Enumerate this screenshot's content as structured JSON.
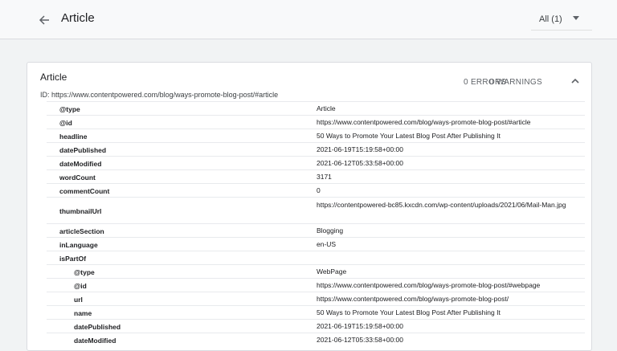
{
  "header": {
    "title": "Article",
    "filter_label": "All (1)"
  },
  "card": {
    "title": "Article",
    "errors": "0 ERRORS",
    "warnings": "0 WARNINGS",
    "id_line": "ID: https://www.contentpowered.com/blog/ways-promote-blog-post/#article"
  },
  "rows": [
    {
      "key": "@type",
      "value": "Article"
    },
    {
      "key": "@id",
      "value": "https://www.contentpowered.com/blog/ways-promote-blog-post/#article"
    },
    {
      "key": "headline",
      "value": "50 Ways to Promote Your Latest Blog Post After Publishing It"
    },
    {
      "key": "datePublished",
      "value": "2021-06-19T15:19:58+00:00"
    },
    {
      "key": "dateModified",
      "value": "2021-06-12T05:33:58+00:00"
    },
    {
      "key": "wordCount",
      "value": "3171"
    },
    {
      "key": "commentCount",
      "value": "0"
    },
    {
      "key": "thumbnailUrl",
      "value": "https://contentpowered-bc85.kxcdn.com/wp-content/uploads/2021/06/Mail-Man.jpg"
    },
    {
      "key": "articleSection",
      "value": "Blogging"
    },
    {
      "key": "inLanguage",
      "value": "en-US"
    },
    {
      "key": "isPartOf",
      "value": ""
    },
    {
      "key": "@type",
      "value": "WebPage"
    },
    {
      "key": "@id",
      "value": "https://www.contentpowered.com/blog/ways-promote-blog-post/#webpage"
    },
    {
      "key": "url",
      "value": "https://www.contentpowered.com/blog/ways-promote-blog-post/"
    },
    {
      "key": "name",
      "value": "50 Ways to Promote Your Latest Blog Post After Publishing It"
    },
    {
      "key": "datePublished",
      "value": "2021-06-19T15:19:58+00:00"
    },
    {
      "key": "dateModified",
      "value": "2021-06-12T05:33:58+00:00"
    }
  ],
  "icons": {
    "back": "arrow-left-icon",
    "filter_caret": "caret-down-icon",
    "collapse": "chevron-up-icon"
  }
}
